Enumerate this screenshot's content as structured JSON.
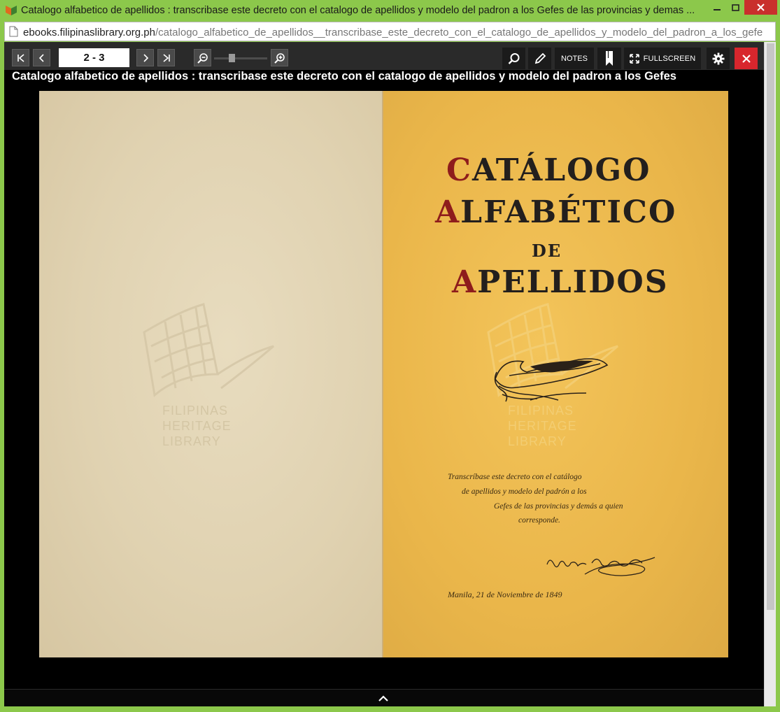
{
  "window": {
    "title": "Catalogo alfabetico de apellidos : transcribase este decreto con el catalogo de apellidos y modelo del padron a los Gefes de las provincias y demas ..."
  },
  "address": {
    "host": "ebooks.filipinaslibrary.org.ph",
    "path": "/catalogo_alfabetico_de_apellidos__transcribase_este_decreto_con_el_catalogo_de_apellidos_y_modelo_del_padron_a_los_gefe"
  },
  "toolbar": {
    "page_indicator": "2 - 3",
    "notes_label": "NOTES",
    "fullscreen_label": "FULLSCREEN",
    "zoom_level": 0.3
  },
  "book": {
    "title": "Catalogo alfabetico de apellidos : transcribase este decreto con el catalogo de apellidos y modelo del padron a los Gefes"
  },
  "page_right": {
    "title_lines": [
      {
        "initial": "C",
        "rest": "ATÁLOGO"
      },
      {
        "initial": "A",
        "rest": "LFABÉTICO"
      },
      {
        "initial": "",
        "rest": "DE"
      },
      {
        "initial": "A",
        "rest": "PELLIDOS"
      }
    ],
    "decree_lines": [
      "Transcríbase este decreto con el catálogo",
      "de apellidos y modelo del padrón a los",
      "Gefes de las provincias y demás a quien",
      "corresponde."
    ],
    "signature": "Narciso Clavería",
    "date_line": "Manila, 21 de Noviembre de 1849"
  },
  "watermark": {
    "lines": [
      "FILIPINAS",
      "HERITAGE",
      "LIBRARY"
    ]
  },
  "colors": {
    "window_frame": "#8cc84b",
    "close_red": "#d8262d",
    "title_red": "#8e1c1c"
  }
}
